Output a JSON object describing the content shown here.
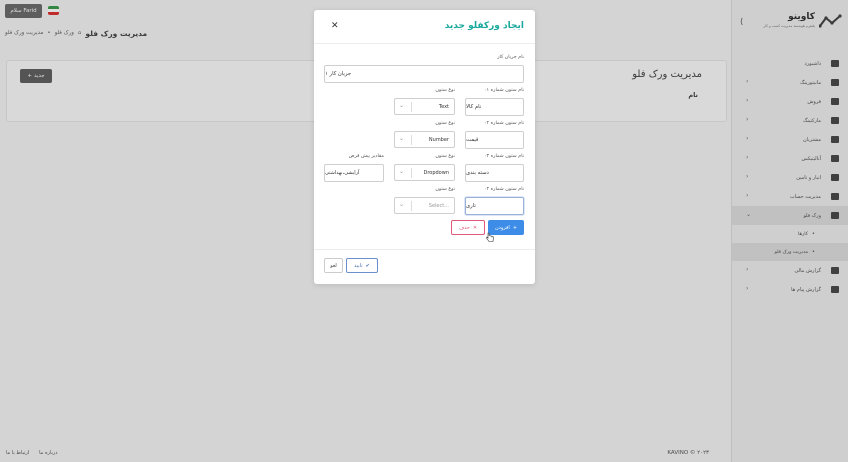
{
  "topbar": {
    "hello_button": "سلام Farid"
  },
  "breadcrumb": {
    "title": "مدیریت ورک فلو",
    "home": "ورک فلو",
    "current": "مدیریت ورک فلو"
  },
  "page": {
    "title": "مدیریت ورک فلو",
    "column_name": "نام",
    "new_button": "جدید"
  },
  "footer": {
    "contact": "ارتباط با ما",
    "about": "درباره ما",
    "brand": "KAVINO ©",
    "year": "۲۰۲۳"
  },
  "sidebar": {
    "logo_text": "کاوینو",
    "logo_sub": "پلتفرم هوشمند مدیریت کسب و کار",
    "items": [
      {
        "label": "داشبورد",
        "icon": "dashboard-icon",
        "chevron": false
      },
      {
        "label": "مانیتورینگ",
        "icon": "monitor-icon",
        "chevron": true
      },
      {
        "label": "فروش",
        "icon": "sales-chart-icon",
        "chevron": true
      },
      {
        "label": "مارکتینگ",
        "icon": "marketing-icon",
        "chevron": true
      },
      {
        "label": "مشتریان",
        "icon": "customers-icon",
        "chevron": true
      },
      {
        "label": "آنالیتیکس",
        "icon": "analytics-icon",
        "chevron": true
      },
      {
        "label": "انبار و تامین",
        "icon": "warehouse-icon",
        "chevron": true
      },
      {
        "label": "مدیریت حساب",
        "icon": "account-icon",
        "chevron": true
      },
      {
        "label": "ورک فلو",
        "icon": "workflow-folder-icon",
        "chevron": true,
        "active": true
      }
    ],
    "subitems": [
      {
        "label": "کارها"
      },
      {
        "label": "مدیریت ورک فلو",
        "active": true
      }
    ],
    "items_after": [
      {
        "label": "گزارش مالی",
        "icon": "finance-report-icon",
        "chevron": true
      },
      {
        "label": "گزارش پیام ها",
        "icon": "messages-report-icon",
        "chevron": true
      }
    ]
  },
  "modal": {
    "title": "ایجاد ورکفلو جدید",
    "workflow_name_label": "نام جریان کار",
    "workflow_name_value": "جریان کار ۱",
    "column_type_label": "نوع ستون",
    "default_values_label": "مقادیر پیش فرض",
    "columns": [
      {
        "name_label": "نام ستون شماره ۰۱",
        "name_value": "نام کالا",
        "type": "Text",
        "default": ""
      },
      {
        "name_label": "نام ستون شماره ۰۲",
        "name_value": "قیمت",
        "type": "Number",
        "default": ""
      },
      {
        "name_label": "نام ستون شماره ۰۳",
        "name_value": "دسته بندی",
        "type": "Dropdown",
        "default": "آرایشی،بهداشتی"
      },
      {
        "name_label": "نام ستون شماره ۰۴",
        "name_value": "تاری",
        "type": "",
        "type_placeholder": "Select...",
        "default": ""
      }
    ],
    "add_button": "افزودن",
    "delete_button": "حذف",
    "confirm_button": "تایید",
    "cancel_button": "لغو"
  },
  "colors": {
    "accent_teal": "#1aa89c",
    "primary_blue": "#3d8de8",
    "danger": "#e05a7a",
    "confirm": "#4a6fae"
  }
}
